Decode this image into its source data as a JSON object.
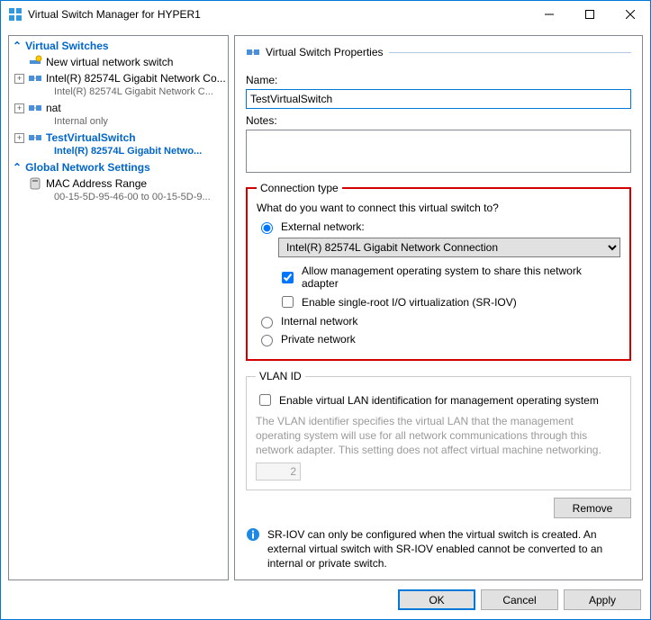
{
  "window": {
    "title": "Virtual Switch Manager for HYPER1"
  },
  "tree": {
    "group1": "Virtual Switches",
    "new_switch": "New virtual network switch",
    "sw1_name": "Intel(R) 82574L Gigabit Network Co...",
    "sw1_sub": "Intel(R) 82574L Gigabit Network C...",
    "sw2_name": "nat",
    "sw2_sub": "Internal only",
    "sw3_name": "TestVirtualSwitch",
    "sw3_sub": "Intel(R) 82574L Gigabit Netwo...",
    "group2": "Global Network Settings",
    "mac_name": "MAC Address Range",
    "mac_sub": "00-15-5D-95-46-00 to 00-15-5D-9..."
  },
  "props": {
    "heading": "Virtual Switch Properties",
    "name_label": "Name:",
    "name_value": "TestVirtualSwitch",
    "notes_label": "Notes:",
    "notes_value": "",
    "conn": {
      "legend": "Connection type",
      "question": "What do you want to connect this virtual switch to?",
      "external": "External network:",
      "adapter": "Intel(R) 82574L Gigabit Network Connection",
      "allow_mgmt": "Allow management operating system to share this network adapter",
      "sriov": "Enable single-root I/O virtualization (SR-IOV)",
      "internal": "Internal network",
      "private": "Private network"
    },
    "vlan": {
      "legend": "VLAN ID",
      "enable": "Enable virtual LAN identification for management operating system",
      "help": "The VLAN identifier specifies the virtual LAN that the management operating system will use for all network communications through this network adapter. This setting does not affect virtual machine networking.",
      "value": "2"
    },
    "remove": "Remove",
    "info": "SR-IOV can only be configured when the virtual switch is created. An external virtual switch with SR-IOV enabled cannot be converted to an internal or private switch."
  },
  "footer": {
    "ok": "OK",
    "cancel": "Cancel",
    "apply": "Apply"
  }
}
